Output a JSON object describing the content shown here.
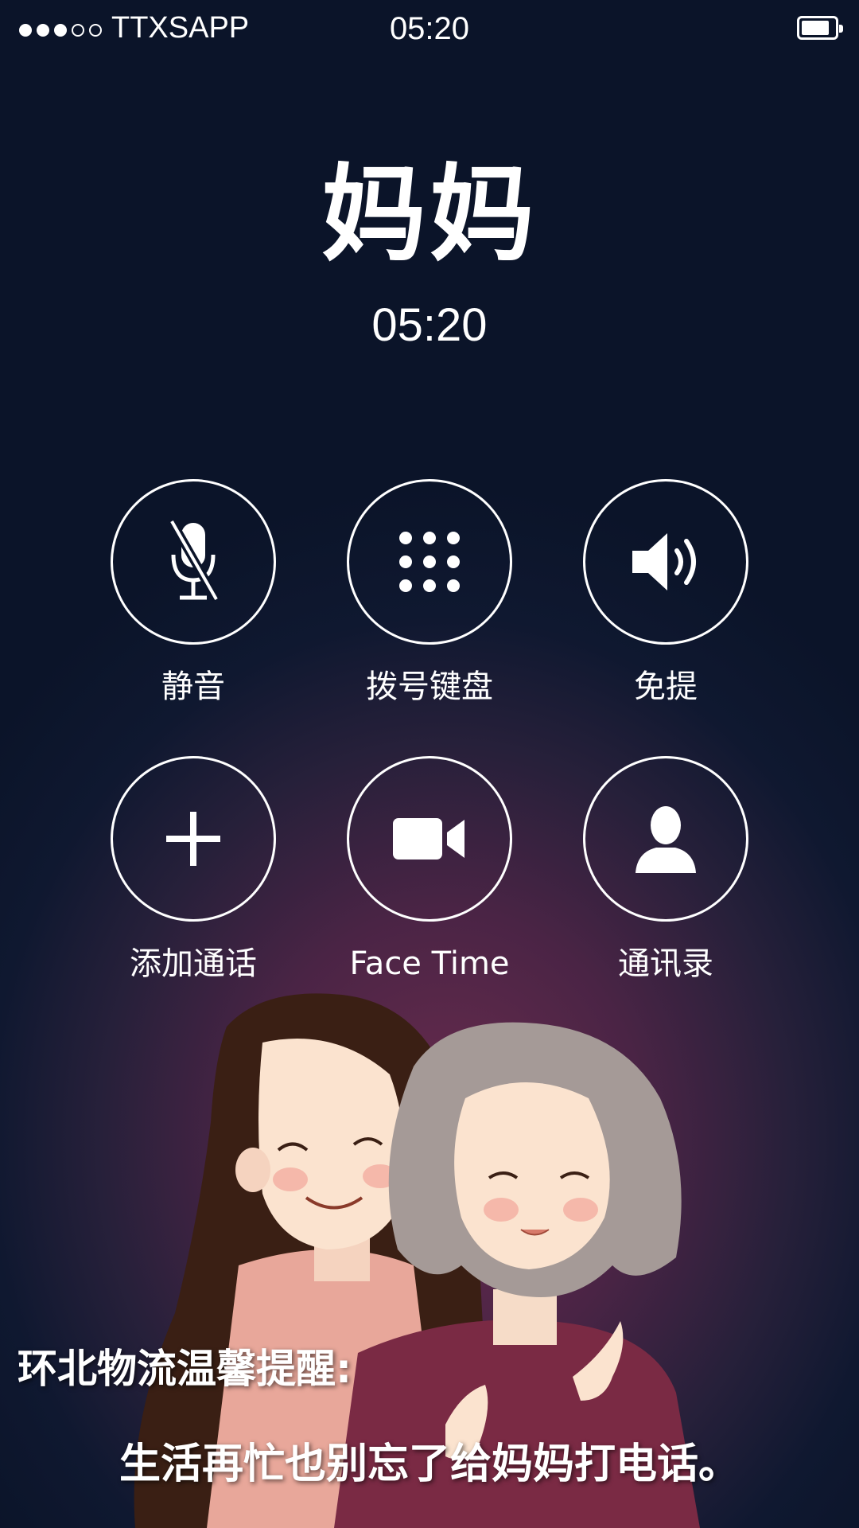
{
  "status_bar": {
    "carrier": "TTXSAPP",
    "time": "05:20",
    "signal_bars_filled": 3,
    "signal_bars_total": 5,
    "battery_icon": "battery-icon"
  },
  "call": {
    "caller_name": "妈妈",
    "duration": "05:20"
  },
  "controls": [
    {
      "label": "静音",
      "icon": "microphone-muted-icon"
    },
    {
      "label": "拨号键盘",
      "icon": "keypad-icon"
    },
    {
      "label": "免提",
      "icon": "speaker-icon"
    },
    {
      "label": "添加通话",
      "icon": "plus-icon"
    },
    {
      "label": "Face Time",
      "icon": "video-camera-icon"
    },
    {
      "label": "通讯录",
      "icon": "contact-person-icon"
    }
  ],
  "reminder": {
    "title": "环北物流温馨提醒:",
    "body": "生活再忙也别忘了给妈妈打电话。"
  },
  "colors": {
    "background_top": "#0b1429",
    "background_glow": "#6b2c4e",
    "foreground": "#ffffff"
  }
}
